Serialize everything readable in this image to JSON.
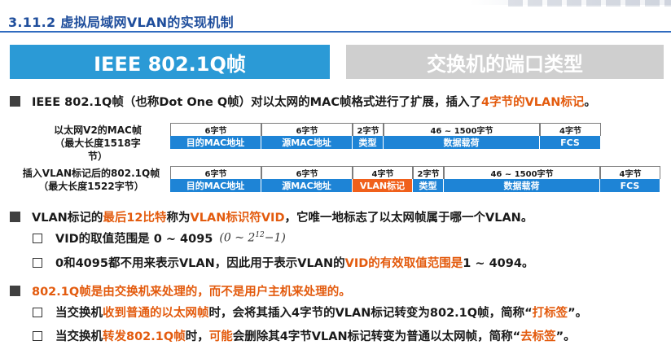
{
  "header": {
    "title": "3.11.2 虚拟局域网VLAN的实现机制"
  },
  "tabs": [
    {
      "label": "IEEE 802.1Q帧"
    },
    {
      "label": "交换机的端口类型"
    }
  ],
  "bullet1": {
    "pre": "IEEE 802.1Q帧（也称Dot One Q帧）对以太网的MAC帧格式进行了扩展，插入了",
    "highlight": "4字节的VLAN标记",
    "post": "。"
  },
  "frame1": {
    "label_line1": "以太网V2的MAC帧",
    "label_line2": "（最大长度1518字节）",
    "fields": [
      {
        "size": "6字节",
        "name": "目的MAC地址"
      },
      {
        "size": "6字节",
        "name": "源MAC地址"
      },
      {
        "size": "2字节",
        "name": "类型"
      },
      {
        "size": "46 ~ 1500字节",
        "name": "数据载荷"
      },
      {
        "size": "4字节",
        "name": "FCS"
      }
    ]
  },
  "frame2": {
    "label_line1": "插入VLAN标记后的802.1Q帧",
    "label_line2": "（最大长度1522字节）",
    "fields": [
      {
        "size": "6字节",
        "name": "目的MAC地址"
      },
      {
        "size": "6字节",
        "name": "源MAC地址"
      },
      {
        "size": "4字节",
        "name": "VLAN标记"
      },
      {
        "size": "2字节",
        "name": "类型"
      },
      {
        "size": "46 ~ 1500字节",
        "name": "数据载荷"
      },
      {
        "size": "4字节",
        "name": "FCS"
      }
    ]
  },
  "bullet2": {
    "pre": "VLAN标记的",
    "highlight1": "最后12比特",
    "mid": "称为",
    "highlight2": "VLAN标识符VID",
    "post": "，它唯一地标志了以太网帧属于哪一个VLAN。"
  },
  "sub1": {
    "text": "VID的取值范围是 0 ~ 4095",
    "formula_open": "(0 ~ 2",
    "formula_exp": "12",
    "formula_close": "−1)"
  },
  "sub2": {
    "pre": "0和4095都不用来表示VLAN，因此用于表示VLAN的",
    "highlight": "VID的有效取值范围是",
    "post": " 1 ~ 4094。"
  },
  "bullet3": {
    "text": "802.1Q帧是由交换机来处理的，而不是用户主机来处理的。"
  },
  "sub3": {
    "pre": "当交换机",
    "highlight1": "收到普通的以太网帧",
    "mid": "时，会将其插入4字节的VLAN标记转变为802.1Q帧，简称“",
    "highlight2": "打标签",
    "post": "”。"
  },
  "sub4": {
    "pre": "当交换机",
    "highlight1": "转发802.1Q帧",
    "mid1": "时，",
    "highlight2": "可能",
    "mid2": "会删除其4字节VLAN标记转变为普通以太网帧，简称“",
    "highlight3": "去标签",
    "post": "”。"
  }
}
